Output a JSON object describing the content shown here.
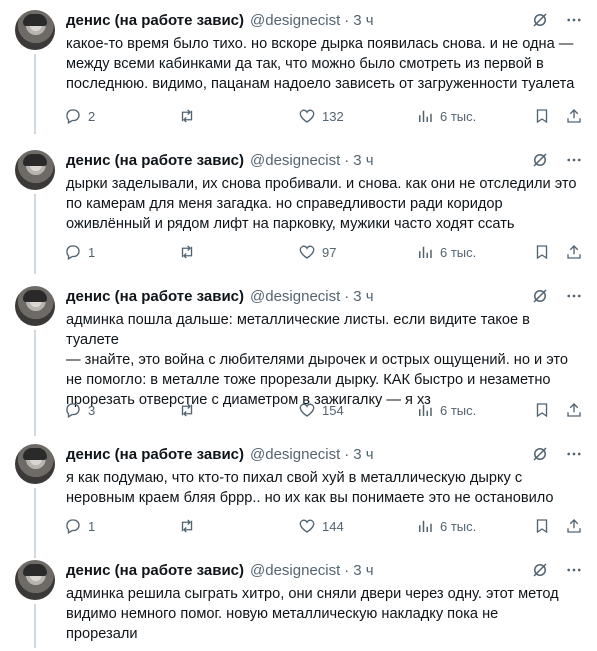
{
  "author": {
    "name": "денис (на работе завис)",
    "handle": "@designecist",
    "time": "3 ч"
  },
  "icons": {
    "grok": "grok-slash-icon",
    "more": "more-dots-icon",
    "reply": "reply-bubble-icon",
    "retweet": "retweet-icon",
    "like": "heart-icon",
    "views": "views-bars-icon",
    "bookmark": "bookmark-icon",
    "share": "share-upload-icon"
  },
  "tweets": [
    {
      "text": "какое-то время было тихо. но вскоре дырка появилась снова. и не одна —\nмежду всеми кабинками да так, что можно было смотреть из первой в\nпоследнюю. видимо, пацанам надоело зависеть от загруженности туалета",
      "replies": "2",
      "retweets": "",
      "likes": "132",
      "views": "6 тыс."
    },
    {
      "text": "дырки заделывали, их снова пробивали. и снова. как они не отследили это\nпо камерам для меня загадка. но справедливости ради коридор\nоживлённый и рядом лифт на парковку, мужики часто ходят ссать",
      "replies": "1",
      "retweets": "",
      "likes": "97",
      "views": "6 тыс."
    },
    {
      "text": "админка пошла дальше: металлические листы. если видите такое в туалете\n— знайте, это война с любителями дырочек и острых ощущений. но и это\nне помогло: в металле тоже прорезали дырку. КАК быстро и незаметно\nпрорезать отверстие с диаметром в зажигалку — я хз",
      "replies": "3",
      "retweets": "",
      "likes": "154",
      "views": "6 тыс."
    },
    {
      "text": "я как подумаю, что кто-то пихал свой хуй в металлическую дырку с\nнеровным краем бляя бррр.. но их как вы понимаете это не остановило",
      "replies": "1",
      "retweets": "",
      "likes": "144",
      "views": "6 тыс."
    },
    {
      "text": "админка решила сыграть хитро, они сняли двери через одну. этот метод\nвидимо немного помог. новую металлическую накладку пока не\nпрорезали"
    }
  ]
}
